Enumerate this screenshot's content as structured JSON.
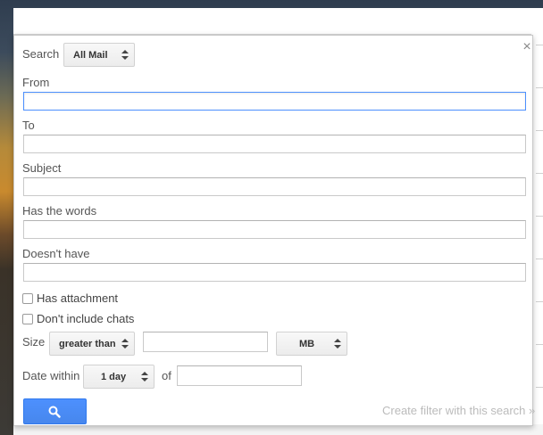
{
  "dialog": {
    "search_label": "Search",
    "search_scope": "All Mail",
    "close_glyph": "×",
    "from_label": "From",
    "to_label": "To",
    "subject_label": "Subject",
    "has_words_label": "Has the words",
    "doesnt_have_label": "Doesn't have",
    "has_attachment_label": "Has attachment",
    "dont_include_chats_label": "Don't include chats",
    "size_label": "Size",
    "size_operator": "greater than",
    "size_value": "",
    "size_unit": "MB",
    "date_within_label": "Date within",
    "date_within_value": "1 day",
    "of_label": "of",
    "date_value": "",
    "search_button_icon": "search-icon",
    "create_filter_link": "Create filter with this search »"
  },
  "fields": {
    "from": "",
    "to": "",
    "subject": "",
    "has_words": "",
    "doesnt_have": ""
  },
  "checkboxes": {
    "has_attachment": false,
    "dont_include_chats": false
  },
  "colors": {
    "primary_button": "#4d90fe",
    "focus_border": "#4d90fe",
    "link_disabled": "#bbbbbb"
  }
}
